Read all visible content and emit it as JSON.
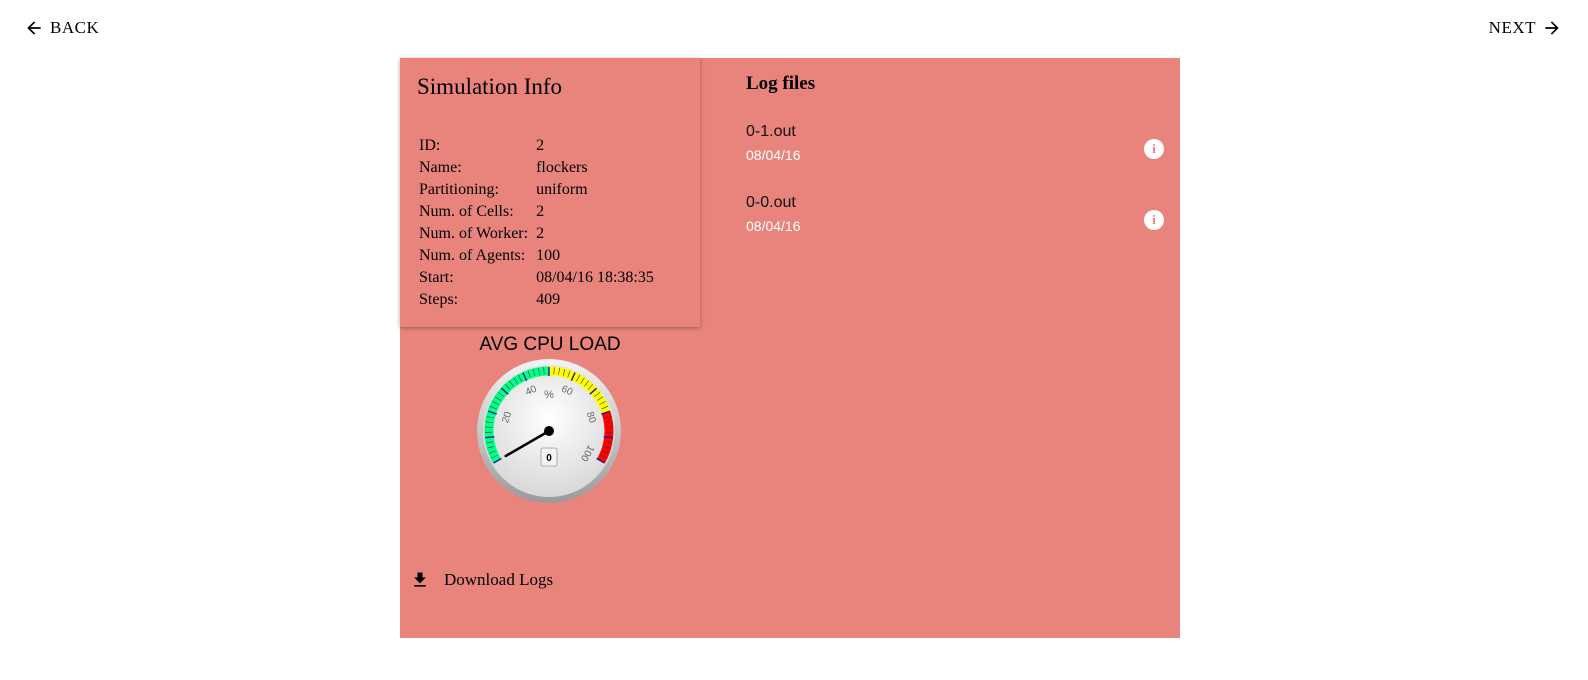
{
  "nav": {
    "back_label": "BACK",
    "next_label": "NEXT"
  },
  "info": {
    "title": "Simulation Info",
    "rows": [
      {
        "label": "ID:",
        "value": "2"
      },
      {
        "label": "Name:",
        "value": "flockers"
      },
      {
        "label": "Partitioning:",
        "value": "uniform"
      },
      {
        "label": "Num. of Cells:",
        "value": "2"
      },
      {
        "label": "Num. of Worker:",
        "value": "2"
      },
      {
        "label": "Num. of Agents:",
        "value": "100"
      },
      {
        "label": "Start:",
        "value": "08/04/16 18:38:35"
      },
      {
        "label": "Steps:",
        "value": "409"
      }
    ]
  },
  "gauge": {
    "title": "AVG CPU LOAD",
    "unit": "%",
    "value": 0,
    "value_text": "0",
    "min": 0,
    "max": 100,
    "ticks": [
      "20",
      "40",
      "60",
      "80",
      "100"
    ],
    "colors": {
      "low": "#00ff88",
      "mid": "#ffff00",
      "high": "#ff0000"
    }
  },
  "download": {
    "label": "Download Logs",
    "icon": "download-icon"
  },
  "logs": {
    "heading": "Log files",
    "files": [
      {
        "name": "0-1.out",
        "date": "08/04/16"
      },
      {
        "name": "0-0.out",
        "date": "08/04/16"
      }
    ]
  },
  "theme": {
    "panel_color": "#e8847c"
  }
}
